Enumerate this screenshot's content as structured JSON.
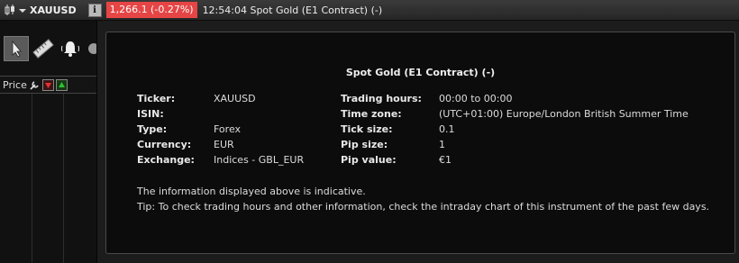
{
  "header": {
    "symbol": "XAUUSD",
    "info_glyph": "i",
    "price_change": "1,266.1 (-0.27%)",
    "price_color": "#e64545",
    "time_and_title": "12:54:04 Spot Gold (E1 Contract) (-)"
  },
  "sidebar": {
    "tools": [
      "cursor-icon",
      "ruler-icon",
      "bell-icon",
      "more-icon"
    ],
    "price_label": "Price"
  },
  "panel": {
    "title": "Spot Gold (E1 Contract) (-)",
    "left": [
      {
        "label": "Ticker:",
        "value": "XAUUSD"
      },
      {
        "label": "ISIN:",
        "value": ""
      },
      {
        "label": "Type:",
        "value": "Forex"
      },
      {
        "label": "Currency:",
        "value": "EUR"
      },
      {
        "label": "Exchange:",
        "value": "Indices - GBL_EUR"
      }
    ],
    "right": [
      {
        "label": "Trading hours:",
        "value": "00:00 to 00:00"
      },
      {
        "label": "Time zone:",
        "value": "(UTC+01:00) Europe/London British Summer Time"
      },
      {
        "label": "Tick size:",
        "value": "0.1"
      },
      {
        "label": "Pip size:",
        "value": "1"
      },
      {
        "label": "Pip value:",
        "value": "€1"
      }
    ],
    "note1": "The information displayed above is indicative.",
    "note2": "Tip: To check trading hours and other information, check the intraday chart of this instrument of the past few days."
  }
}
